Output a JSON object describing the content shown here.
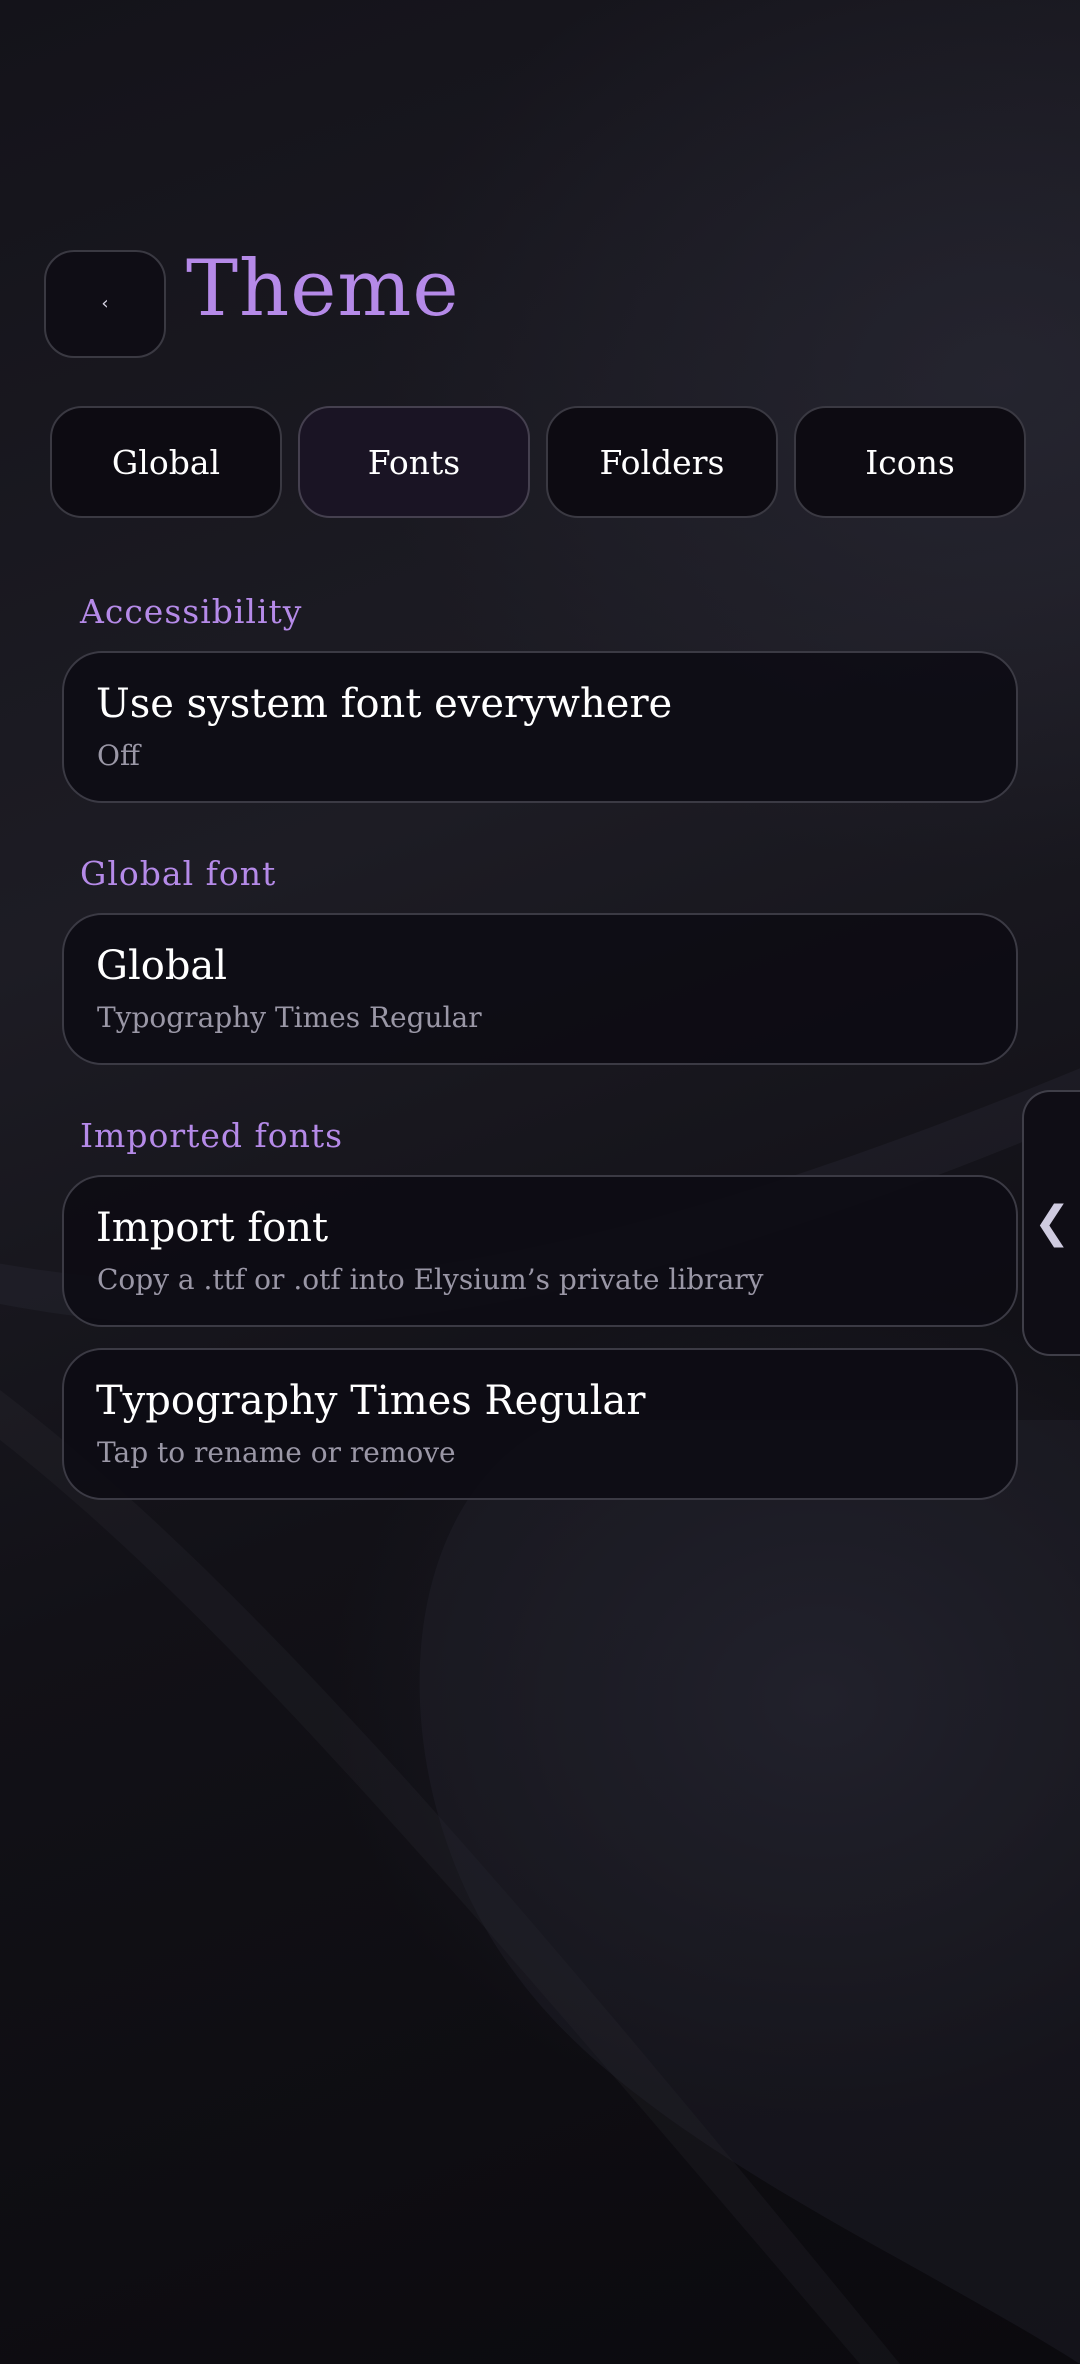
{
  "header": {
    "back_icon": "‹",
    "title": "Theme"
  },
  "tabs": [
    {
      "label": "Global",
      "active": false
    },
    {
      "label": "Fonts",
      "active": true
    },
    {
      "label": "Folders",
      "active": false
    },
    {
      "label": "Icons",
      "active": false
    }
  ],
  "sections": {
    "accessibility": {
      "label": "Accessibility",
      "items": [
        {
          "title": "Use system font everywhere",
          "subtitle": "Off"
        }
      ]
    },
    "global_font": {
      "label": "Global font",
      "items": [
        {
          "title": "Global",
          "subtitle": "Typography Times Regular"
        }
      ]
    },
    "imported_fonts": {
      "label": "Imported fonts",
      "items": [
        {
          "title": "Import font",
          "subtitle": "Copy a .ttf or .otf into Elysium’s private library"
        },
        {
          "title": "Typography Times Regular",
          "subtitle": "Tap to rename or remove"
        }
      ]
    }
  },
  "side_handle": {
    "icon": "❮"
  },
  "colors": {
    "accent": "#b58ae8",
    "background": "#0c0b10",
    "card": "#0d0b13",
    "border": "#3b3a44",
    "subtitle": "#9a97a6"
  }
}
